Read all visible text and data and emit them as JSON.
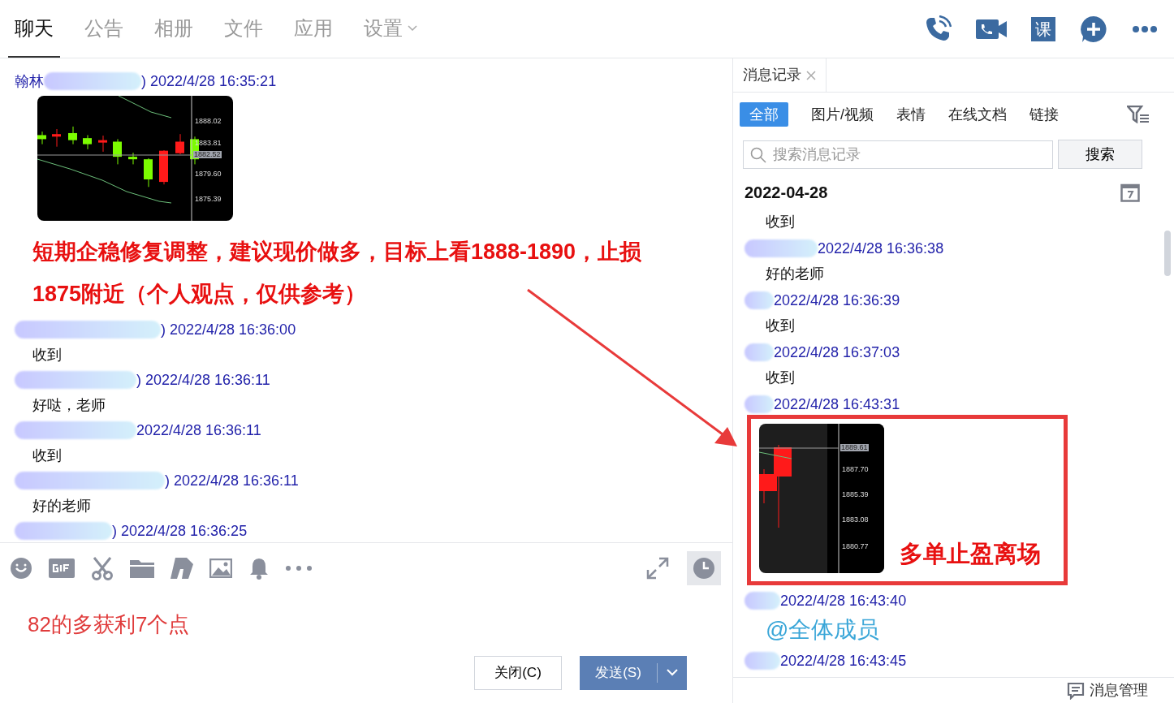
{
  "tabs": [
    {
      "label": "聊天",
      "selected": true
    },
    {
      "label": "公告",
      "selected": false
    },
    {
      "label": "相册",
      "selected": false
    },
    {
      "label": "文件",
      "selected": false
    },
    {
      "label": "应用",
      "selected": false
    },
    {
      "label": "设置",
      "selected": false,
      "dropdown": true
    }
  ],
  "header_actions": {
    "course": "课"
  },
  "chat": {
    "messages": [
      {
        "kind": "image",
        "sender": "翰林",
        "header": ") 2022/4/28 16:35:21",
        "image": {
          "axis_labels": [
            "1888.02",
            "1883.81",
            "1879.60",
            "1875.39"
          ],
          "price_tag": "1882.52"
        }
      },
      {
        "kind": "highlight",
        "text": "短期企稳修复调整，建议现价做多，目标上看1888-1890，止损1875附近（个人观点，仅供参考）"
      },
      {
        "kind": "text",
        "header": ") 2022/4/28 16:36:00",
        "text": "收到"
      },
      {
        "kind": "text",
        "header": ") 2022/4/28 16:36:11",
        "text": "好哒，老师"
      },
      {
        "kind": "text",
        "header": "2022/4/28 16:36:11",
        "text": "收到"
      },
      {
        "kind": "text",
        "header": ") 2022/4/28 16:36:11",
        "text": "好的老师"
      },
      {
        "kind": "text",
        "header": ") 2022/4/28 16:36:25"
      }
    ]
  },
  "composer": {
    "draft": "82的多获利7个点",
    "close_button": "关闭(C)",
    "send_button": "发送(S)"
  },
  "history": {
    "tab": "消息记录",
    "filters": [
      {
        "label": "全部",
        "selected": true
      },
      {
        "label": "图片/视频",
        "selected": false
      },
      {
        "label": "表情",
        "selected": false
      },
      {
        "label": "在线文档",
        "selected": false
      },
      {
        "label": "链接",
        "selected": false
      }
    ],
    "search": {
      "placeholder": "搜索消息记录",
      "button": "搜索"
    },
    "date": "2022-04-28",
    "messages": [
      {
        "kind": "text",
        "text": "收到"
      },
      {
        "kind": "text",
        "header": "2022/4/28 16:36:38",
        "text": "好的老师"
      },
      {
        "kind": "text",
        "header": "2022/4/28 16:36:39",
        "text": "收到"
      },
      {
        "kind": "text",
        "header": "2022/4/28 16:37:03",
        "text": "收到"
      },
      {
        "kind": "image",
        "header": "2022/4/28 16:43:31",
        "image": {
          "axis_labels": [
            "1887.70",
            "1885.39",
            "1883.08",
            "1880.77"
          ],
          "price_tag": "1889.61"
        }
      },
      {
        "kind": "mention",
        "header": "2022/4/28 16:43:40",
        "text": "@全体成员"
      },
      {
        "kind": "text",
        "header": "2022/4/28 16:43:45"
      }
    ],
    "manage_button": "消息管理"
  },
  "annotation": {
    "text": "多单止盈离场"
  }
}
